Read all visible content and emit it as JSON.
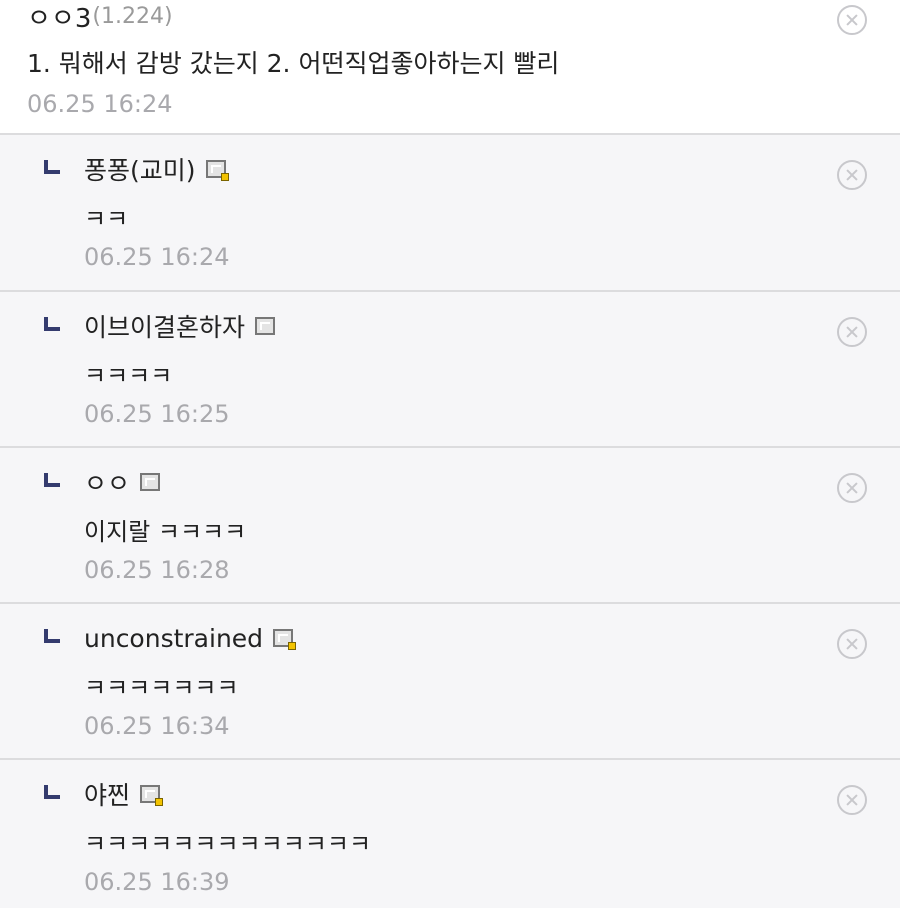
{
  "main_comment": {
    "nickname": "ㅇㅇ3",
    "ip": "(1.224)",
    "body": "1. 뭐해서 감방 갔는지 2. 어떤직업좋아하는지 빨리",
    "date": "06.25 16:24",
    "delete_icon": "close-circle-icon"
  },
  "replies": [
    {
      "nickname": "퐁퐁(교미)",
      "badge_icon": "gallog-icon",
      "fixed_user": true,
      "body": "ㅋㅋ",
      "date": "06.25 16:24"
    },
    {
      "nickname": "이브이결혼하자",
      "badge_icon": "gallog-icon",
      "fixed_user": false,
      "body": "ㅋㅋㅋㅋ",
      "date": "06.25 16:25"
    },
    {
      "nickname": "ㅇㅇ",
      "badge_icon": "gallog-icon",
      "fixed_user": false,
      "body": "이지랄 ㅋㅋㅋㅋ",
      "date": "06.25 16:28"
    },
    {
      "nickname": "unconstrained",
      "badge_icon": "gallog-icon",
      "fixed_user": true,
      "body": "ㅋㅋㅋㅋㅋㅋㅋ",
      "date": "06.25 16:34"
    },
    {
      "nickname": "야찐",
      "badge_icon": "gallog-icon",
      "fixed_user": true,
      "body": "ㅋㅋㅋㅋㅋㅋㅋㅋㅋㅋㅋㅋㅋ",
      "date": "06.25 16:39"
    }
  ],
  "colors": {
    "reply_background": "#f6f6f8",
    "divider": "#dcdcde",
    "reply_arrow": "#343b6e",
    "date_text": "#a9a9ad",
    "fixed_user_badge": "#f3c300"
  }
}
